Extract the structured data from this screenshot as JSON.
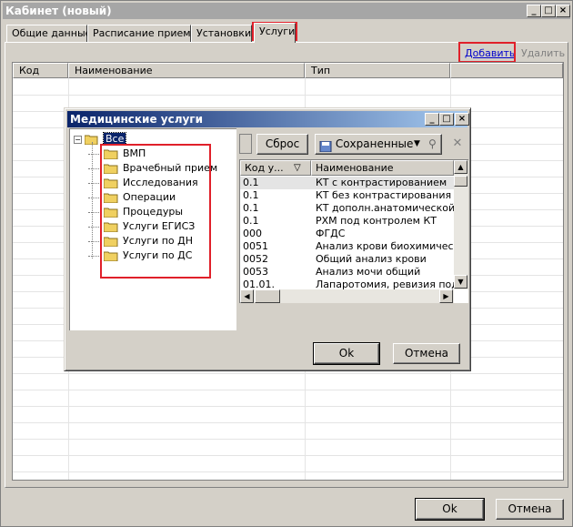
{
  "window": {
    "title": "Кабинет (новый)",
    "controls": [
      "_",
      "□",
      "×"
    ]
  },
  "tabs": [
    {
      "label": "Общие данные"
    },
    {
      "label": "Расписание приема"
    },
    {
      "label": "Установки"
    },
    {
      "label": "Услуги",
      "active": true
    }
  ],
  "toolbar": {
    "add_label": "Добавить",
    "delete_label": "Удалить"
  },
  "grid": {
    "columns": [
      "Код",
      "Наименование",
      "Тип"
    ]
  },
  "footer": {
    "ok_label": "Ok",
    "cancel_label": "Отмена"
  },
  "dialog": {
    "title": "Медицинские услуги",
    "controls": [
      "_",
      "□",
      "×"
    ],
    "tree": {
      "root": "Все",
      "items": [
        "ВМП",
        "Врачебный прием",
        "Исследования",
        "Операции",
        "Процедуры",
        "Услуги ЕГИСЗ",
        "Услуги по ДН",
        "Услуги по ДС"
      ]
    },
    "reset_label": "Сброс",
    "saved_label": "Сохраненные",
    "columns": [
      "Код у...",
      "Наименование"
    ],
    "rows": [
      {
        "code": "0.1",
        "name": "КТ с контрастированием"
      },
      {
        "code": "0.1",
        "name": "КТ без контрастирования"
      },
      {
        "code": "0.1",
        "name": "КТ дополн.анатомической об"
      },
      {
        "code": "0.1",
        "name": "РХМ под контролем КТ"
      },
      {
        "code": "000",
        "name": "ФГДС"
      },
      {
        "code": "0051",
        "name": "Анализ крови биохимический"
      },
      {
        "code": "0052",
        "name": "Общий  анализ крови"
      },
      {
        "code": "0053",
        "name": "Анализ мочи общий"
      },
      {
        "code": "01.01.",
        "name": "Лапаротомия, ревизия подже"
      }
    ],
    "ok_label": "Ok",
    "cancel_label": "Отмена"
  }
}
